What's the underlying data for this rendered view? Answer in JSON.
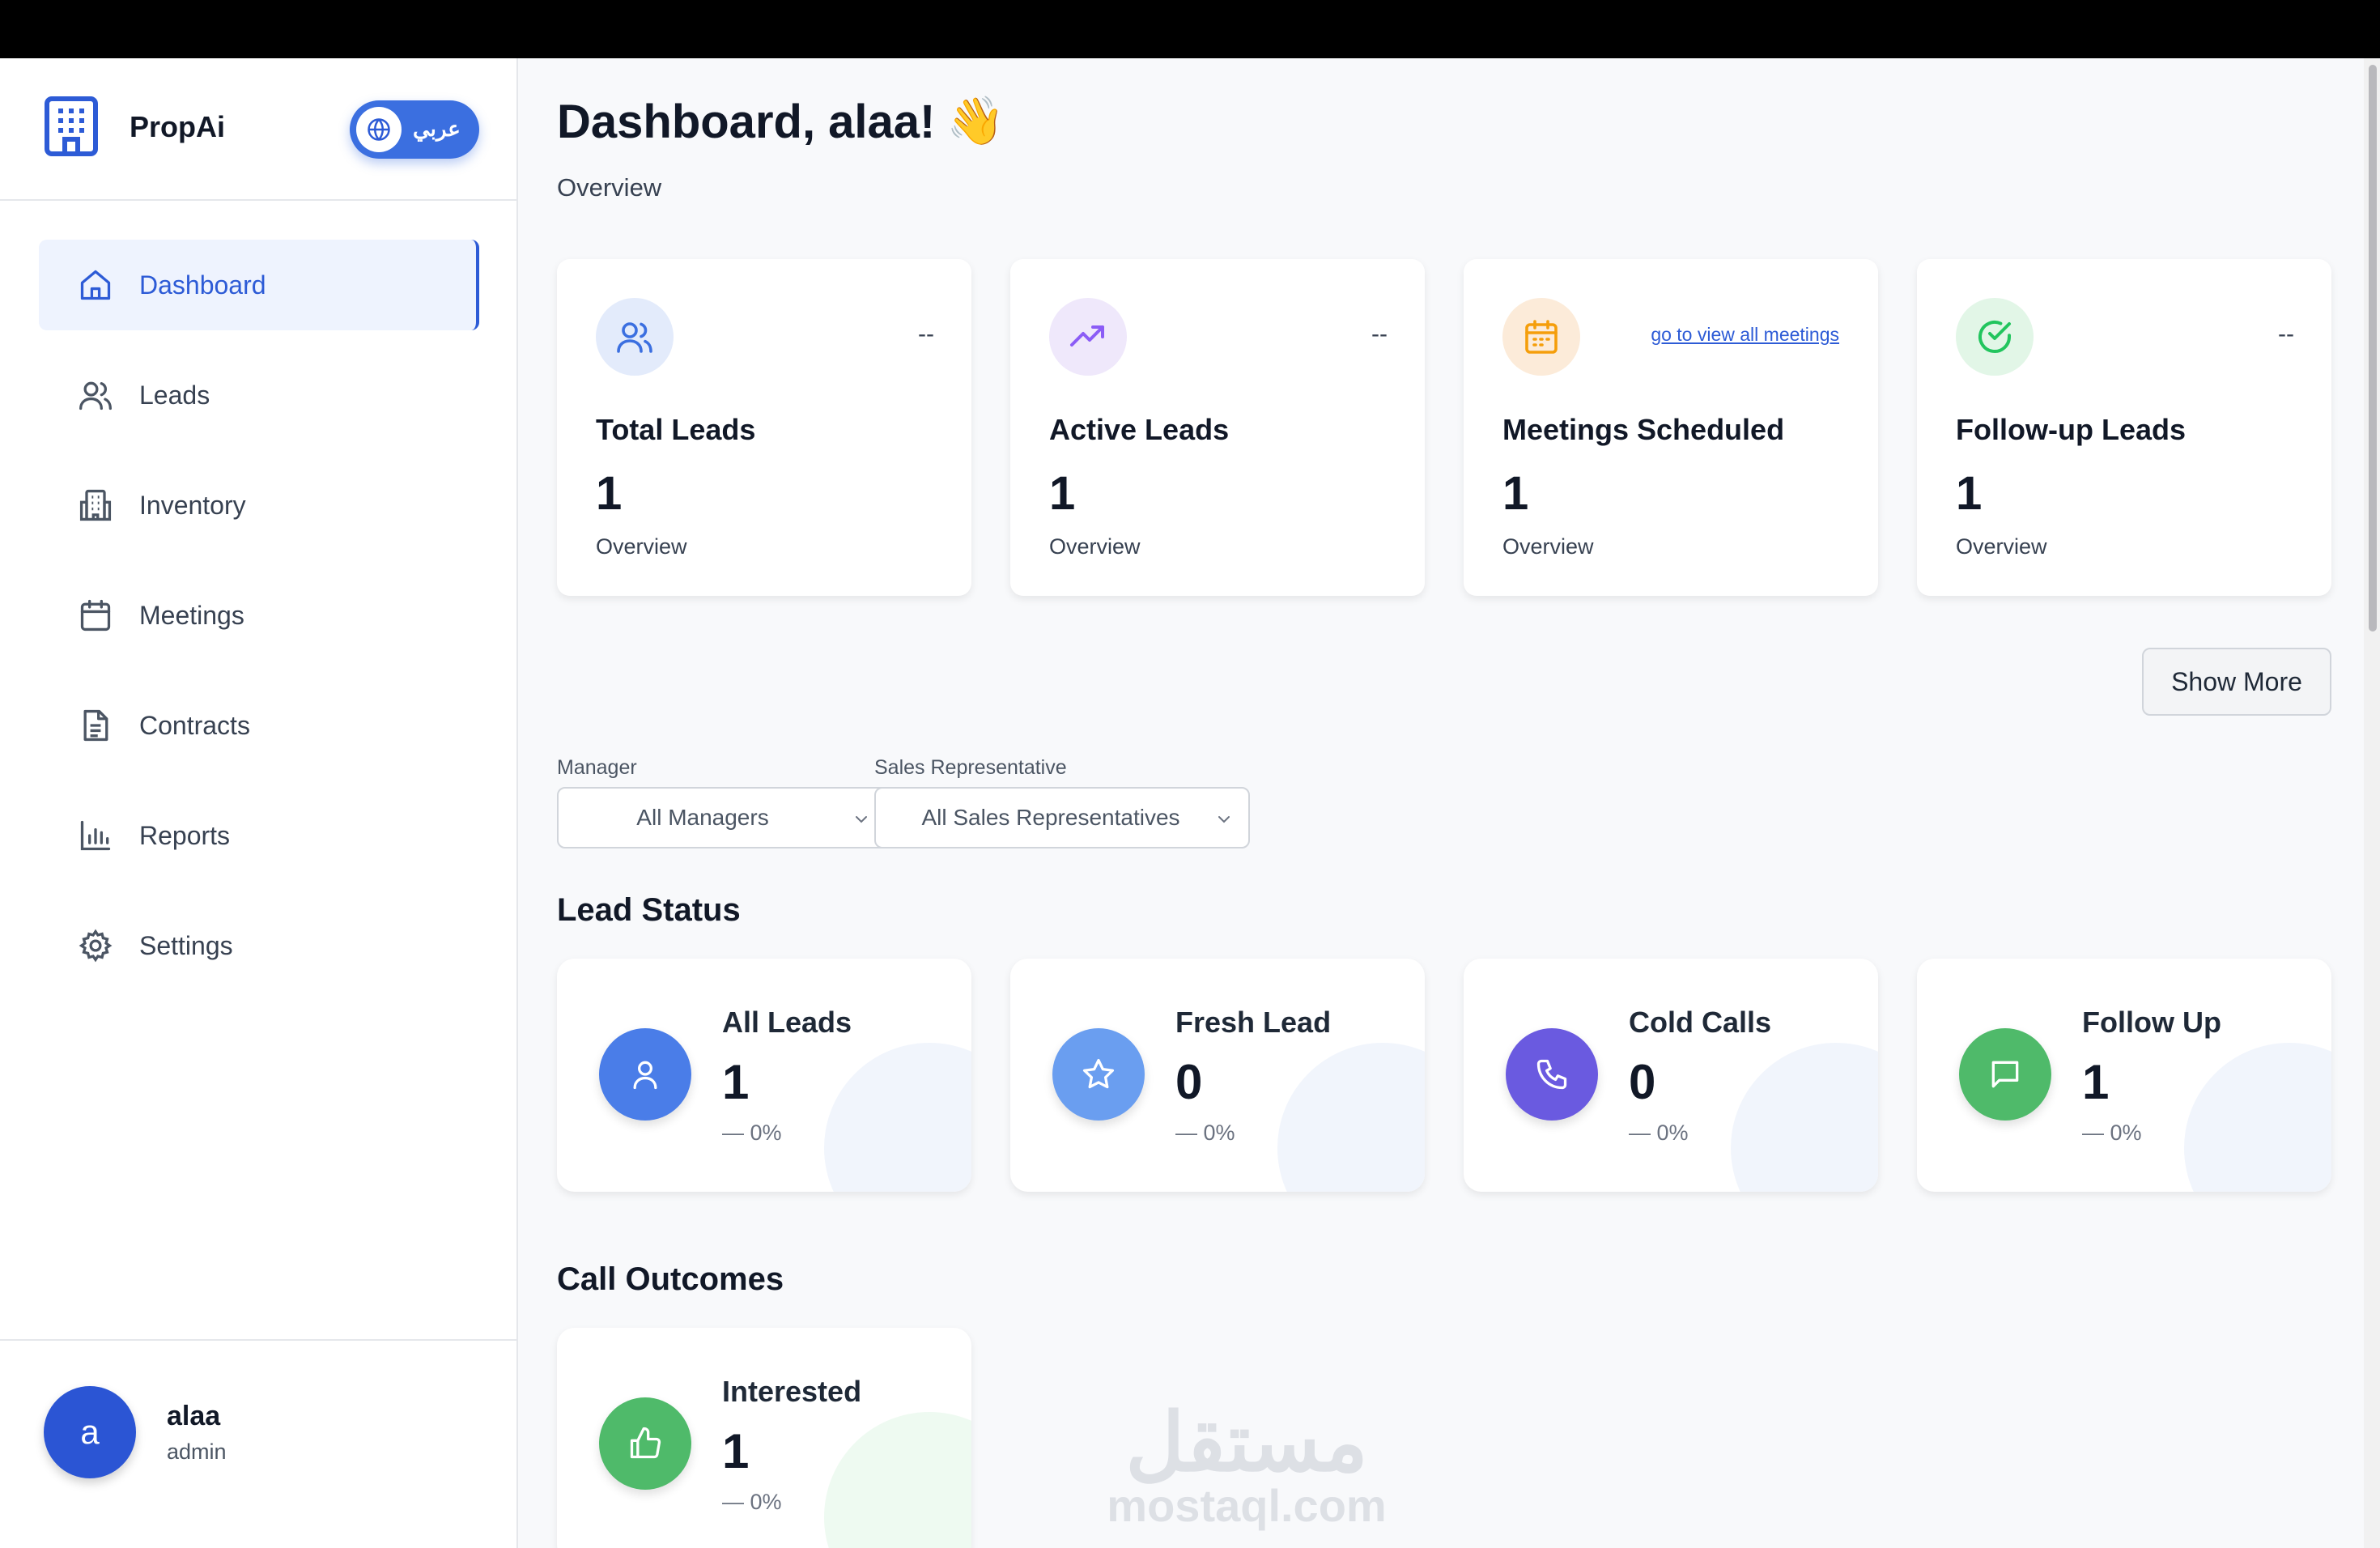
{
  "brand": {
    "name": "PropAi",
    "language_toggle": "عربي"
  },
  "sidebar": {
    "items": [
      {
        "label": "Dashboard",
        "icon": "home-icon",
        "active": true
      },
      {
        "label": "Leads",
        "icon": "users-icon"
      },
      {
        "label": "Inventory",
        "icon": "building-icon"
      },
      {
        "label": "Meetings",
        "icon": "calendar-icon"
      },
      {
        "label": "Contracts",
        "icon": "document-icon"
      },
      {
        "label": "Reports",
        "icon": "bar-chart-icon"
      },
      {
        "label": "Settings",
        "icon": "gear-icon"
      }
    ]
  },
  "user": {
    "initial": "a",
    "name": "alaa",
    "role": "admin"
  },
  "header": {
    "title": "Dashboard, alaa!",
    "emoji": "👋",
    "subtitle": "Overview"
  },
  "stats": [
    {
      "title": "Total Leads",
      "value": "1",
      "sub": "Overview",
      "corner": "--",
      "icon": "users-icon",
      "color": "#3b6fe0"
    },
    {
      "title": "Active Leads",
      "value": "1",
      "sub": "Overview",
      "corner": "--",
      "icon": "trending-up-icon",
      "color": "#8b5cf6"
    },
    {
      "title": "Meetings Scheduled",
      "value": "1",
      "sub": "Overview",
      "link": "go to view all meetings",
      "icon": "calendar-icon",
      "color": "#f59e0b"
    },
    {
      "title": "Follow-up Leads",
      "value": "1",
      "sub": "Overview",
      "corner": "--",
      "icon": "check-circle-icon",
      "color": "#22c55e"
    }
  ],
  "actions": {
    "show_more": "Show More"
  },
  "filters": {
    "manager": {
      "label": "Manager",
      "value": "All Managers"
    },
    "sales_rep": {
      "label": "Sales Representative",
      "value": "All Sales Representatives"
    }
  },
  "lead_status": {
    "title": "Lead Status",
    "cards": [
      {
        "title": "All Leads",
        "value": "1",
        "pct": "— 0%",
        "icon": "user-icon",
        "color": "#4a7de8"
      },
      {
        "title": "Fresh Lead",
        "value": "0",
        "pct": "— 0%",
        "icon": "star-icon",
        "color": "#6a9ef0"
      },
      {
        "title": "Cold Calls",
        "value": "0",
        "pct": "— 0%",
        "icon": "phone-icon",
        "color": "#6a5ae0"
      },
      {
        "title": "Follow Up",
        "value": "1",
        "pct": "— 0%",
        "icon": "message-icon",
        "color": "#4fba6a"
      }
    ]
  },
  "call_outcomes": {
    "title": "Call Outcomes",
    "cards": [
      {
        "title": "Interested",
        "value": "1",
        "pct": "— 0%",
        "icon": "thumbs-up-icon",
        "color": "#4fba6a"
      }
    ]
  },
  "watermark": {
    "arabic": "مستقل",
    "latin": "mostaql.com"
  }
}
